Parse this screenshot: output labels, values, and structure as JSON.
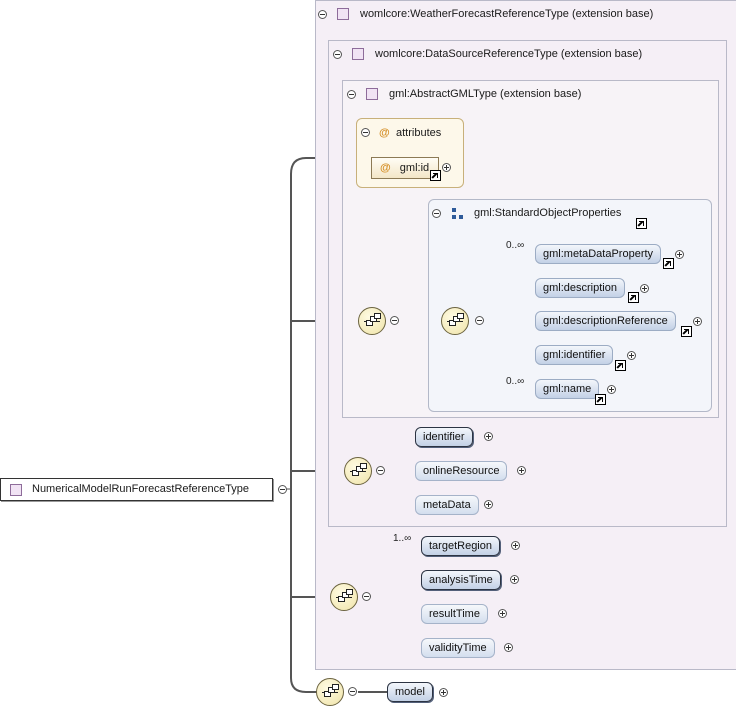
{
  "root_type": "NumericalModelRunForecastReferenceType",
  "extensions": {
    "weather_forecast": "womlcore:WeatherForecastReferenceType (extension base)",
    "data_source": "womlcore:DataSourceReferenceType (extension base)",
    "abstract_gml": "gml:AbstractGMLType (extension base)"
  },
  "attributes": {
    "label": "attributes",
    "at_symbol": "@",
    "gml_id": "gml:id"
  },
  "standard_object_properties": {
    "label": "gml:StandardObjectProperties",
    "elements": [
      {
        "name": "gml:metaDataProperty",
        "occurs": "0..∞"
      },
      {
        "name": "gml:description",
        "occurs": ""
      },
      {
        "name": "gml:descriptionReference",
        "occurs": ""
      },
      {
        "name": "gml:identifier",
        "occurs": ""
      },
      {
        "name": "gml:name",
        "occurs": "0..∞"
      }
    ]
  },
  "data_source_elements": [
    "identifier",
    "onlineResource",
    "metaData"
  ],
  "forecast_elements": [
    {
      "name": "targetRegion",
      "occurs": "1..∞"
    },
    {
      "name": "analysisTime",
      "occurs": ""
    },
    {
      "name": "resultTime",
      "occurs": ""
    },
    {
      "name": "validityTime",
      "occurs": ""
    }
  ],
  "model_element": "model",
  "colors": {
    "frame_fill": "#f5eff6",
    "element_gradient_top": "#f3f6fb",
    "element_gradient_bottom": "#c3d1e6",
    "attribute_fill": "#fdf8ea",
    "sequence_fill": "#efe3a8"
  }
}
